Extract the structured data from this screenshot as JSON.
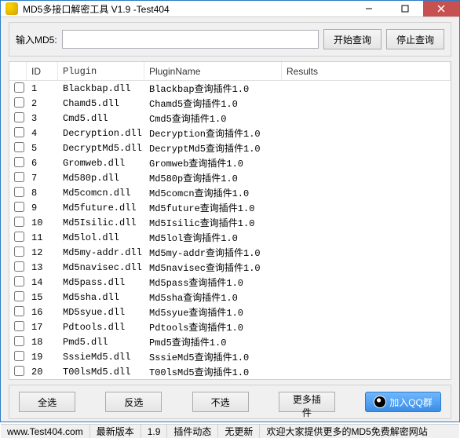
{
  "window": {
    "title": "MD5多接口解密工具 V1.9       -Test404"
  },
  "input": {
    "label": "输入MD5:",
    "start": "开始查询",
    "stop": "停止查询"
  },
  "table": {
    "headers": {
      "id": "ID",
      "plugin": "Plugin",
      "name": "PluginName",
      "results": "Results"
    },
    "rows": [
      {
        "id": "1",
        "plugin": "Blackbap.dll",
        "name": "Blackbap查询插件1.0",
        "results": ""
      },
      {
        "id": "2",
        "plugin": "Chamd5.dll",
        "name": "Chamd5查询插件1.0",
        "results": ""
      },
      {
        "id": "3",
        "plugin": "Cmd5.dll",
        "name": "Cmd5查询插件1.0",
        "results": ""
      },
      {
        "id": "4",
        "plugin": "Decryption.dll",
        "name": "Decryption查询插件1.0",
        "results": ""
      },
      {
        "id": "5",
        "plugin": "DecryptMd5.dll",
        "name": "DecryptMd5查询插件1.0",
        "results": ""
      },
      {
        "id": "6",
        "plugin": "Gromweb.dll",
        "name": "Gromweb查询插件1.0",
        "results": ""
      },
      {
        "id": "7",
        "plugin": "Md580p.dll",
        "name": "Md580p查询插件1.0",
        "results": ""
      },
      {
        "id": "8",
        "plugin": "Md5comcn.dll",
        "name": "Md5comcn查询插件1.0",
        "results": ""
      },
      {
        "id": "9",
        "plugin": "Md5future.dll",
        "name": "Md5future查询插件1.0",
        "results": ""
      },
      {
        "id": "10",
        "plugin": "Md5Isilic.dll",
        "name": "Md5Isilic查询插件1.0",
        "results": ""
      },
      {
        "id": "11",
        "plugin": "Md5lol.dll",
        "name": "Md5lol查询插件1.0",
        "results": ""
      },
      {
        "id": "12",
        "plugin": "Md5my-addr.dll",
        "name": "Md5my-addr查询插件1.0",
        "results": ""
      },
      {
        "id": "13",
        "plugin": "Md5navisec.dll",
        "name": "Md5navisec查询插件1.0",
        "results": ""
      },
      {
        "id": "14",
        "plugin": "Md5pass.dll",
        "name": "Md5pass查询插件1.0",
        "results": ""
      },
      {
        "id": "15",
        "plugin": "Md5sha.dll",
        "name": "Md5sha查询插件1.0",
        "results": ""
      },
      {
        "id": "16",
        "plugin": "MD5syue.dll",
        "name": "Md5syue查询插件1.0",
        "results": ""
      },
      {
        "id": "17",
        "plugin": "Pdtools.dll",
        "name": "Pdtools查询插件1.0",
        "results": ""
      },
      {
        "id": "18",
        "plugin": "Pmd5.dll",
        "name": "Pmd5查询插件1.0",
        "results": ""
      },
      {
        "id": "19",
        "plugin": "SssieMd5.dll",
        "name": "SssieMd5查询插件1.0",
        "results": ""
      },
      {
        "id": "20",
        "plugin": "T00lsMd5.dll",
        "name": "T00lsMd5查询插件1.0",
        "results": ""
      }
    ]
  },
  "buttons": {
    "select_all": "全选",
    "invert": "反选",
    "none": "不选",
    "more_plugins": "更多插件",
    "qq_group": "加入QQ群"
  },
  "status": {
    "site": "www.Test404.com",
    "version_label": "最新版本",
    "version": "1.9",
    "plugin_news": "插件动态",
    "update": "无更新",
    "welcome": "欢迎大家提供更多的MD5免费解密网站"
  }
}
